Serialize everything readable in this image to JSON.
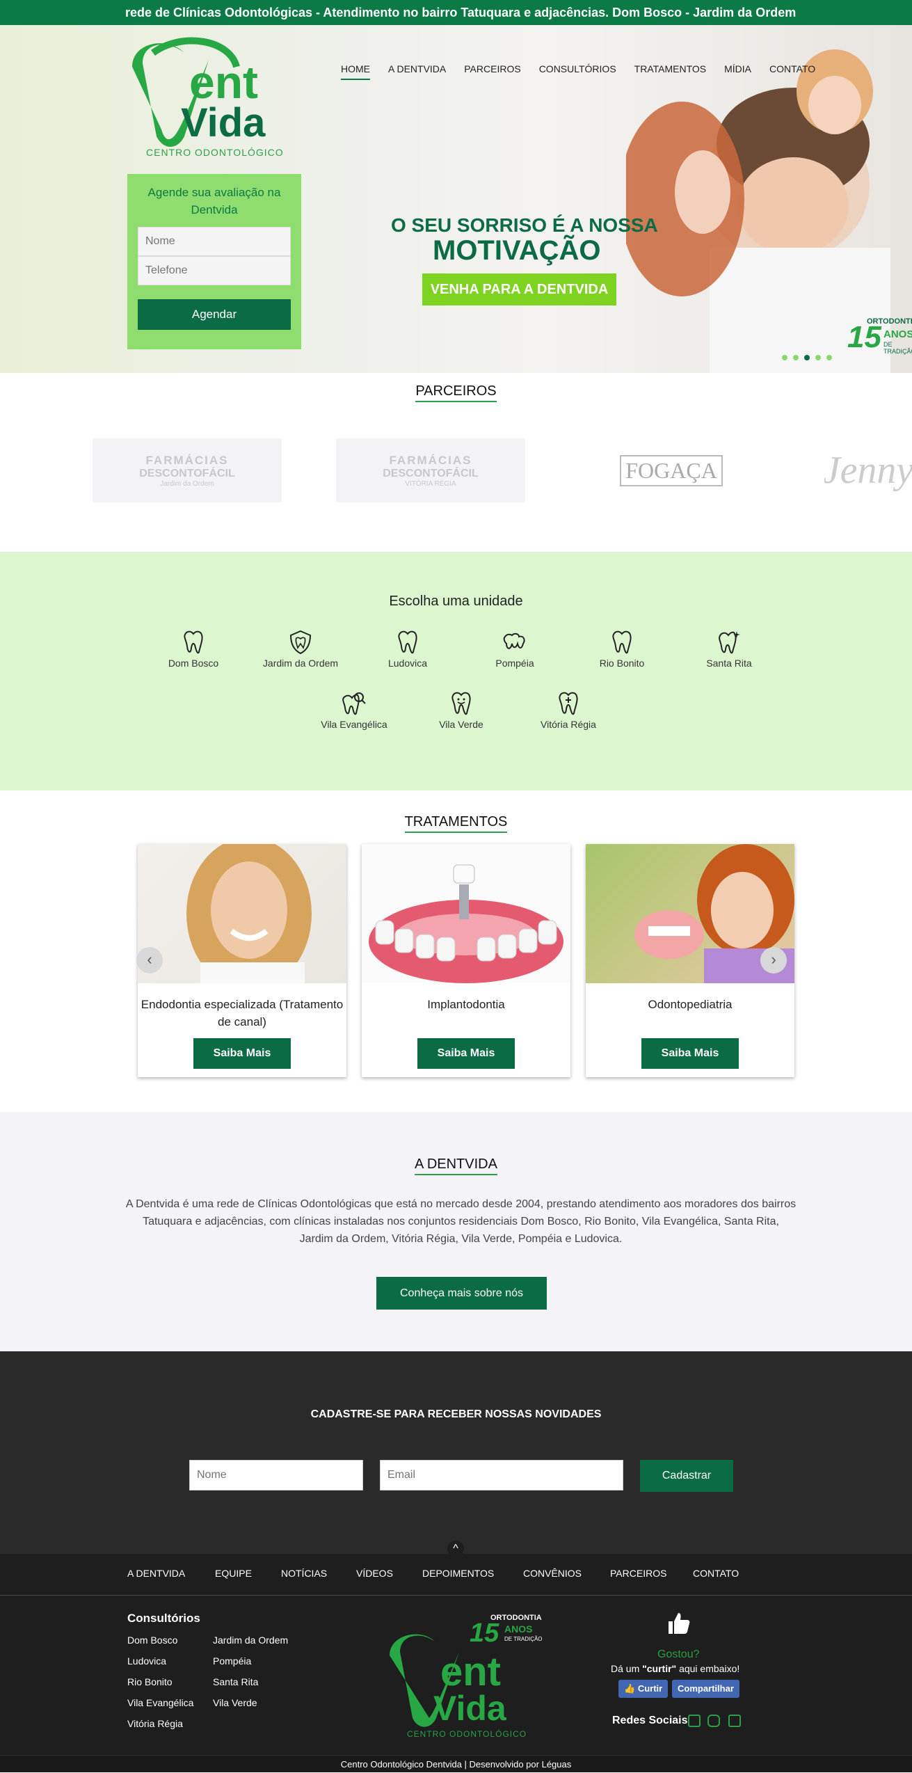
{
  "ticker": "rede de Clínicas Odontológicas - Atendimento no bairro Tatuquara e adjacências. Dom Bosco - Jardim da Ordem - Ludovica - Pompéia",
  "logo": {
    "line1": "ent",
    "line2": "Vida",
    "sub": "CENTRO ODONTOLÓGICO"
  },
  "nav": [
    "HOME",
    "A DENTVIDA",
    "PARCEIROS",
    "CONSULTÓRIOS",
    "TRATAMENTOS",
    "MÍDIA",
    "CONTATO"
  ],
  "form": {
    "title": "Agende sua avaliação na Dentvida",
    "name_ph": "Nome",
    "phone_ph": "Telefone",
    "button": "Agendar"
  },
  "hero": {
    "line1": "O SEU SORRISO É A NOSSA",
    "line2": "MOTIVAÇÃO",
    "button": "VENHA PARA A DENTVIDA",
    "badge_top": "ORTODONTIA",
    "badge_num": "15",
    "badge_anos": "ANOS",
    "badge_sub": "DE TRADIÇÃO"
  },
  "partners": {
    "title": "PARCEIROS",
    "items": [
      {
        "name": "FARMÁCIAS",
        "sub": "DESCONTOFÁCIL",
        "loc": "Jardim da Ordem"
      },
      {
        "name": "FARMÁCIAS",
        "sub": "DESCONTOFÁCIL",
        "loc": "VITÓRIA RÉGIA"
      },
      {
        "name": "FOGAÇA",
        "sub": "",
        "loc": ""
      },
      {
        "name": "Jenny",
        "sub": "",
        "loc": ""
      }
    ]
  },
  "units": {
    "title": "Escolha uma unidade",
    "items": [
      "Dom Bosco",
      "Jardim da Ordem",
      "Ludovica",
      "Pompéia",
      "Rio Bonito",
      "Santa Rita",
      "Vila Evangélica",
      "Vila Verde",
      "Vitória Régia"
    ]
  },
  "treatments": {
    "title": "TRATAMENTOS",
    "items": [
      {
        "title": "Endodontia especializada (Tratamento de canal)",
        "button": "Saiba Mais"
      },
      {
        "title": "Implantodontia",
        "button": "Saiba Mais"
      },
      {
        "title": "Odontopediatria",
        "button": "Saiba Mais"
      }
    ],
    "prev": "‹",
    "next": "›"
  },
  "about": {
    "title": "A DENTVIDA",
    "text": "A Dentvida é uma rede de Clínicas Odontológicas que está no mercado desde 2004, prestando atendimento aos moradores dos bairros Tatuquara e adjacências, com clínicas instaladas nos conjuntos residenciais Dom Bosco, Rio Bonito, Vila Evangélica, Santa Rita, Jardim da Ordem, Vitória Régia, Vila Verde, Pompéia e Ludovica.",
    "button": "Conheça mais sobre nós"
  },
  "newsletter": {
    "title": "CADASTRE-SE PARA RECEBER NOSSAS NOVIDADES",
    "name_ph": "Nome",
    "email_ph": "Email",
    "button": "Cadastrar"
  },
  "footer_nav": [
    "A DENTVIDA",
    "EQUIPE",
    "NOTÍCIAS",
    "VÍDEOS",
    "DEPOIMENTOS",
    "CONVÊNIOS",
    "PARCEIROS",
    "CONTATO"
  ],
  "up": "^",
  "consultorios": {
    "title": "Consultórios",
    "col1": [
      "Dom Bosco",
      "Ludovica",
      "Rio Bonito",
      "Vila Evangélica",
      "Vitória Régia"
    ],
    "col2": [
      "Jardim da Ordem",
      "Pompéia",
      "Santa Rita",
      "Vila Verde"
    ]
  },
  "social": {
    "gostou": "Gostou?",
    "curtir_pre": "Dá um ",
    "curtir_word": "\"curtir\"",
    "curtir_post": " aqui embaixo!",
    "like": "Curtir",
    "share": "Compartilhar",
    "redes": "Redes Sociais"
  },
  "copyright": "Centro Odontológico Dentvida  |  Desenvolvido por Léguas",
  "colors": {
    "brand": "#0b6b45",
    "light": "#8fdc6f",
    "accent": "#7ed321"
  }
}
